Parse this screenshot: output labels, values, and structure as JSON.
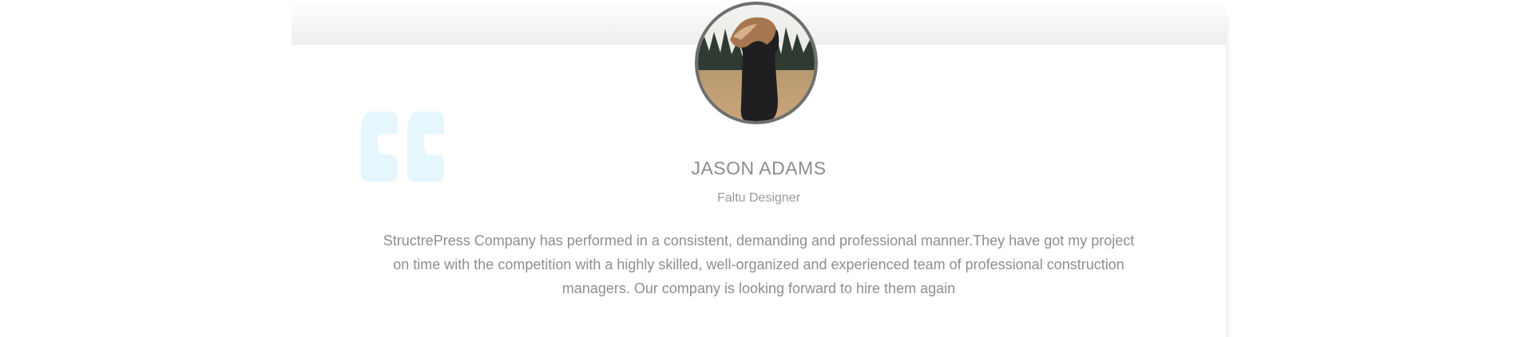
{
  "testimonial": {
    "name": "JASON ADAMS",
    "role": "Faltu Designer",
    "text": "StructrePress Company has performed in a consistent, demanding and professional manner.They have got my project on time with the competition with a highly skilled, well-organized and experienced team of professional construction managers. Our company is looking forward to hire them again",
    "avatar_icon": "person-photo",
    "quote_icon": "quote-icon"
  },
  "colors": {
    "quote_icon": "#e6f6fd",
    "avatar_border": "#6f6f6f",
    "text": "#8e8e8e"
  }
}
